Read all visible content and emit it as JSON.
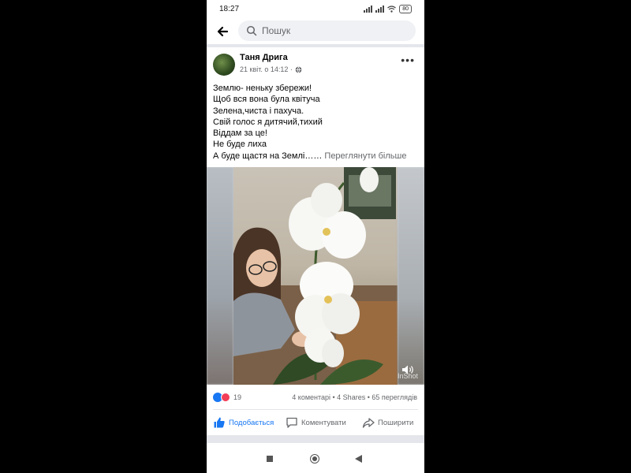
{
  "status_bar": {
    "time": "18:27",
    "battery": "80"
  },
  "search": {
    "placeholder": "Пошук"
  },
  "post": {
    "author": "Таня Дрига",
    "date": "21 квіт. о 14:12 ·",
    "text_lines": [
      "Землю- неньку збережи!",
      "Щоб вся вона була квітуча",
      "Зелена,чиста і пахуча.",
      "Свій голос я дитячий,тихий",
      "Віддам за це!",
      "Не буде лиха"
    ],
    "last_line": "А буде щастя на Землі……",
    "see_more": "Переглянути більше",
    "video_watermark": "InShot",
    "reaction_count": "19",
    "stats": "4 коментарі • 4 Shares • 65 переглядів"
  },
  "actions": {
    "like": "Подобається",
    "comment": "Коментувати",
    "share": "Поширити"
  },
  "colors": {
    "accent": "#1877f2",
    "secondary_text": "#65676b",
    "divider": "#e4e6eb"
  },
  "icons": [
    "back-arrow-icon",
    "search-icon",
    "globe-icon",
    "more-icon",
    "mute-icon",
    "like-icon",
    "comment-icon",
    "share-icon"
  ]
}
